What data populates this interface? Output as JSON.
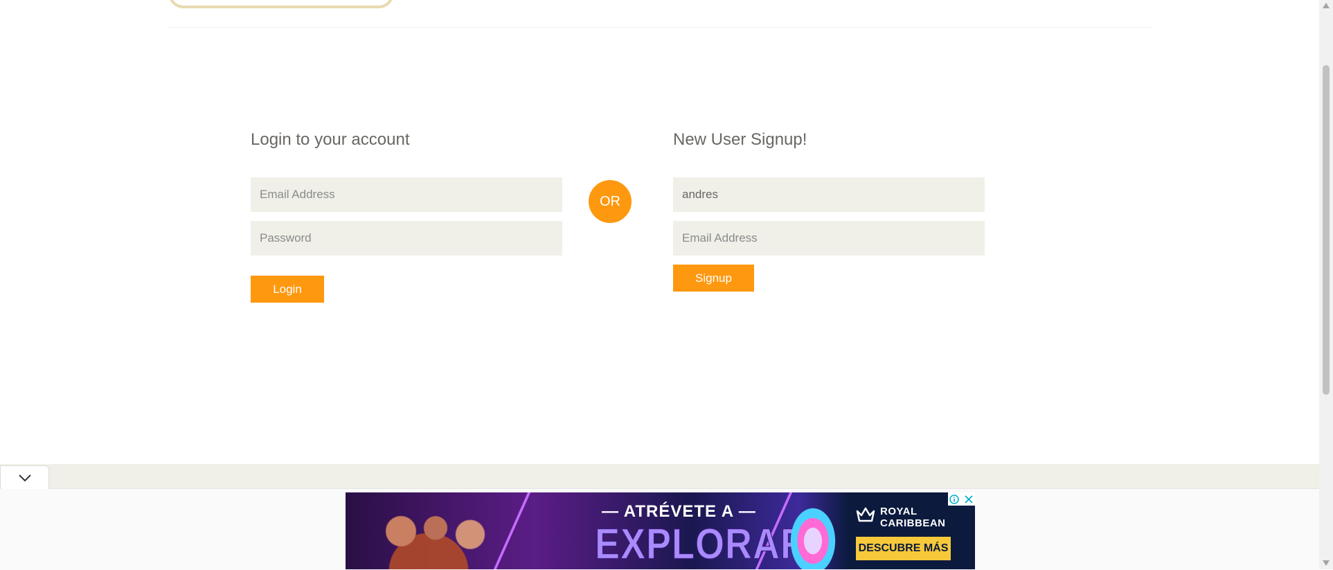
{
  "login": {
    "title": "Login to your account",
    "email_placeholder": "Email Address",
    "password_placeholder": "Password",
    "button_label": "Login"
  },
  "divider": {
    "label": "OR"
  },
  "signup": {
    "title": "New User Signup!",
    "name_value": "andres",
    "email_placeholder": "Email Address",
    "button_label": "Signup"
  },
  "ad": {
    "tagline": "— ATRÉVETE A —",
    "headline": "EXPLORAR",
    "brand_line1": "ROYAL",
    "brand_line2": "CARIBBEAN",
    "cta_label": "DESCUBRE MÁS",
    "info_icon": "info-icon",
    "close_icon": "close-icon"
  },
  "icons": {
    "collapse": "chevron-down-icon",
    "scroll_up": "triangle-up-icon",
    "scroll_down": "triangle-down-icon",
    "brand": "crown-icon"
  },
  "colors": {
    "accent": "#fe980f",
    "field_bg": "#f0f0e9",
    "text": "#696763"
  }
}
